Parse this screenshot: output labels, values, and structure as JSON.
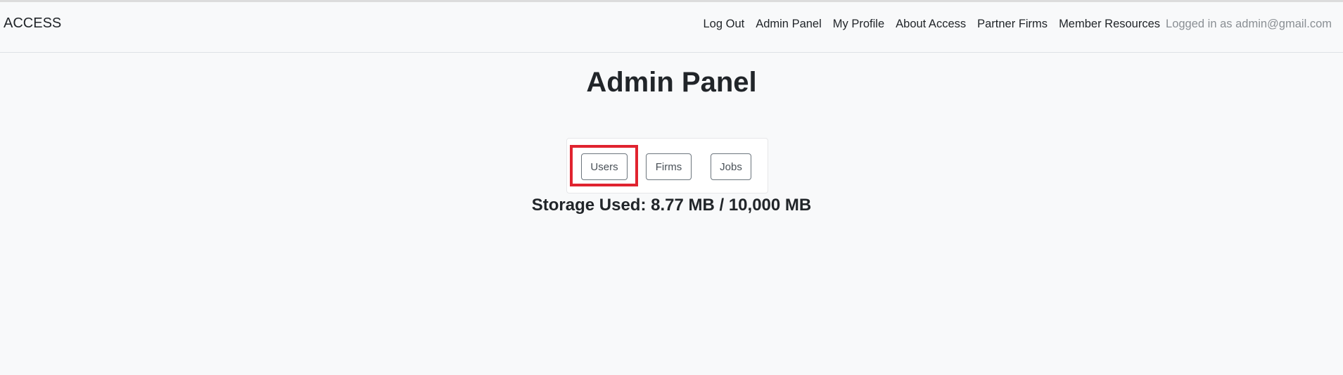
{
  "navbar": {
    "brand": "ACCESS",
    "links": [
      {
        "label": "Log Out"
      },
      {
        "label": "Admin Panel"
      },
      {
        "label": "My Profile"
      },
      {
        "label": "About Access"
      },
      {
        "label": "Partner Firms"
      },
      {
        "label": "Member Resources"
      }
    ],
    "status_text": "Logged in as admin@gmail.com"
  },
  "main": {
    "title": "Admin Panel",
    "buttons": [
      {
        "label": "Users"
      },
      {
        "label": "Firms"
      },
      {
        "label": "Jobs"
      }
    ],
    "storage_text": "Storage Used: 8.77 MB / 10,000 MB"
  },
  "colors": {
    "background": "#f8f9fa",
    "highlight": "#e0232f",
    "button_border": "#6c757d"
  }
}
